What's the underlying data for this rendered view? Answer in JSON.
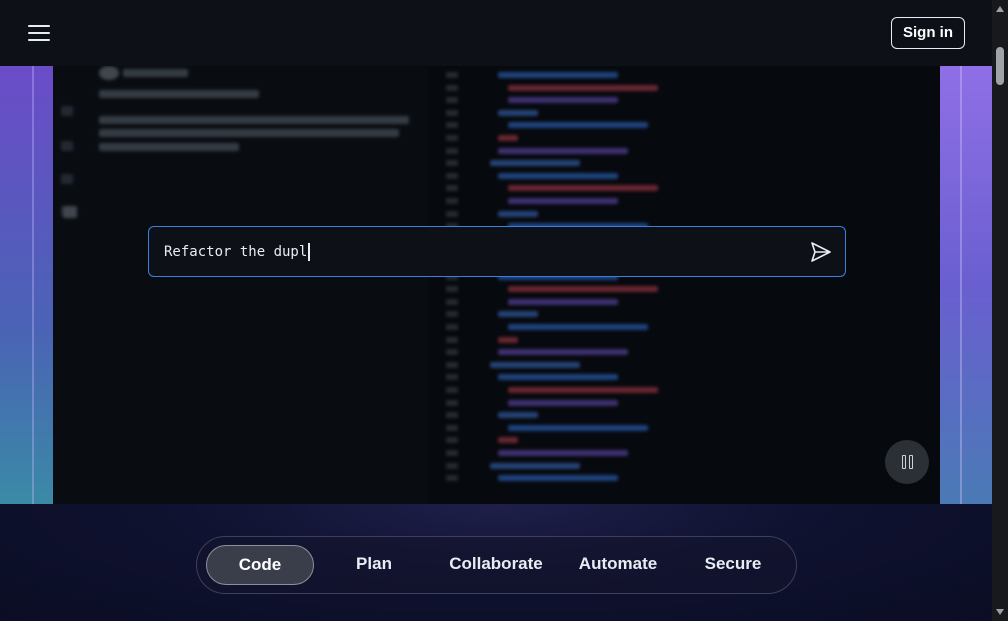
{
  "header": {
    "menu_icon": "hamburger-icon",
    "logo_icon": "github-logo-icon",
    "signin_label": "Sign in"
  },
  "prompt": {
    "value": "Refactor the dupl",
    "send_icon": "send-icon"
  },
  "player": {
    "pause_icon": "pause-icon"
  },
  "tabs": [
    {
      "label": "Code",
      "active": true
    },
    {
      "label": "Plan",
      "active": false
    },
    {
      "label": "Collaborate",
      "active": false
    },
    {
      "label": "Automate",
      "active": false
    },
    {
      "label": "Secure",
      "active": false
    }
  ],
  "colors": {
    "background": "#0d1117",
    "accent_border": "#3b7fe0",
    "stage_purple": "#5a3fb8",
    "stage_teal": "#3b86a8",
    "active_tab": "#3a3e4a"
  }
}
